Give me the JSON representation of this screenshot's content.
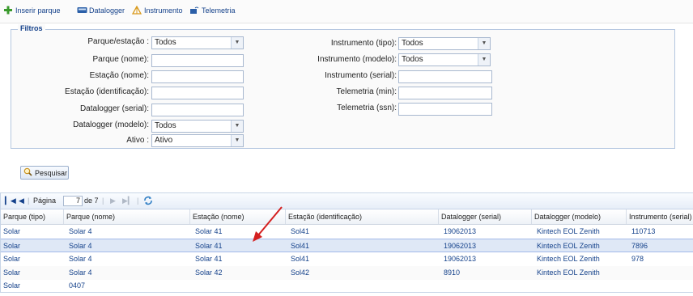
{
  "toolbar": {
    "insert_park": "Inserir parque",
    "datalogger": "Datalogger",
    "instrument": "Instrumento",
    "telemetry": "Telemetria"
  },
  "filters": {
    "legend": "Filtros",
    "left": [
      {
        "label": "Parque/estação :",
        "type": "select",
        "value": "Todos"
      },
      {
        "label": "Parque (nome):",
        "type": "input",
        "value": ""
      },
      {
        "label": "Estação (nome):",
        "type": "input",
        "value": ""
      },
      {
        "label": "Estação (identificação):",
        "type": "input",
        "value": ""
      },
      {
        "label": "Datalogger (serial):",
        "type": "input",
        "value": ""
      },
      {
        "label": "Datalogger (modelo):",
        "type": "select",
        "value": "Todos"
      },
      {
        "label": "Ativo :",
        "type": "select",
        "value": "Ativo"
      }
    ],
    "right": [
      {
        "label": "Instrumento (tipo):",
        "type": "select",
        "value": "Todos"
      },
      {
        "label": "Instrumento (modelo):",
        "type": "select",
        "value": "Todos"
      },
      {
        "label": "Instrumento (serial):",
        "type": "input",
        "value": ""
      },
      {
        "label": "Telemetria (min):",
        "type": "input",
        "value": ""
      },
      {
        "label": "Telemetria (ssn):",
        "type": "input",
        "value": ""
      }
    ]
  },
  "search_button": "Pesquisar",
  "pager": {
    "page_label": "Página",
    "page_value": "7",
    "of_label": "de 7"
  },
  "columns": [
    "Parque (tipo)",
    "Parque (nome)",
    "Estação (nome)",
    "Estação (identificação)",
    "Datalogger (serial)",
    "Datalogger (modelo)",
    "Instrumento (serial)"
  ],
  "rows": [
    [
      "Solar",
      "Solar 4",
      "Solar 41",
      "Sol41",
      "19062013",
      "Kintech EOL Zenith",
      "110713"
    ],
    [
      "Solar",
      "Solar 4",
      "Solar 41",
      "Sol41",
      "19062013",
      "Kintech EOL Zenith",
      "7896"
    ],
    [
      "Solar",
      "Solar 4",
      "Solar 41",
      "Sol41",
      "19062013",
      "Kintech EOL Zenith",
      "978"
    ],
    [
      "Solar",
      "Solar 4",
      "Solar 42",
      "Sol42",
      "8910",
      "Kintech EOL Zenith",
      ""
    ],
    [
      "Solar",
      "0407",
      "",
      "",
      "",
      "",
      ""
    ]
  ],
  "colors": {
    "accent": "#15428b",
    "selected_row": "#dfe8f6",
    "annotation_arrow": "#d42020"
  }
}
